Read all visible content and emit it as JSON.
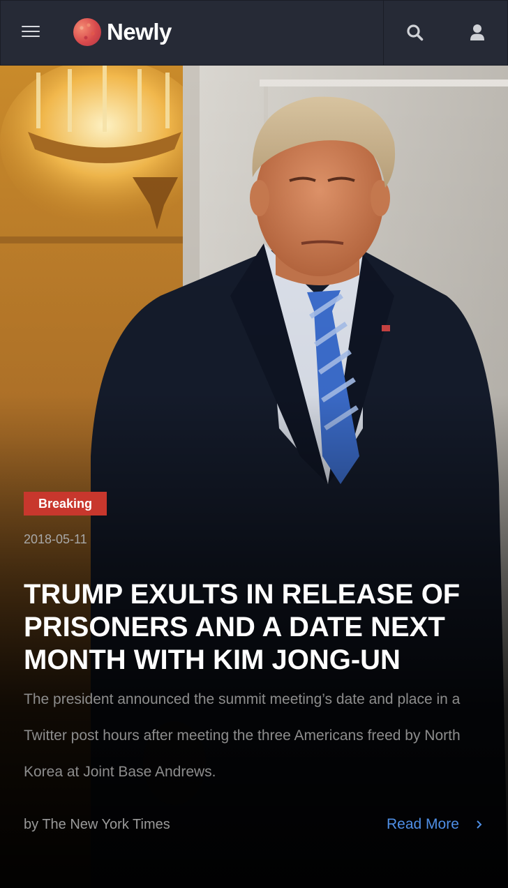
{
  "header": {
    "brand_name": "Newly",
    "icons": {
      "menu": "hamburger-icon",
      "logo": "dotted-globe-logo",
      "search": "search-icon",
      "user": "user-icon"
    },
    "colors": {
      "background": "#262a36",
      "brand_text": "#ffffff",
      "icon": "#d9dbe0"
    }
  },
  "article": {
    "badge": "Breaking",
    "date": "2018-05-11",
    "title": "TRUMP EXULTS IN RELEASE OF PRISONERS AND A DATE NEXT MONTH WITH KIM JONG-UN",
    "summary": "The president announced the summit meeting’s date and place in a Twitter post hours after meeting the three Americans freed by North Korea at Joint Base Andrews.",
    "byline": "by The New York Times",
    "read_more": "Read More",
    "colors": {
      "badge": "#c8372d",
      "link": "#4f8fe6",
      "title": "#ffffff"
    }
  }
}
